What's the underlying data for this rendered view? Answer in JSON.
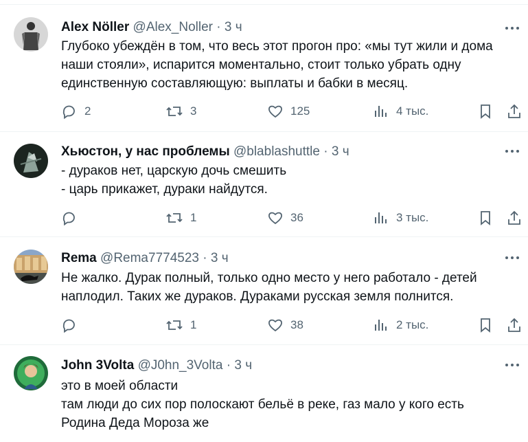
{
  "tweets": [
    {
      "name": "Alex Nöller",
      "handle": "@Alex_Noller",
      "time": "3 ч",
      "lines": [
        "Глубоко убеждён в том, что весь этот прогон про: «мы тут жили и дома",
        "наши стояли», испарится моментально, стоит только убрать одну",
        "единственную составляющую: выплаты и бабки в месяц."
      ],
      "replies": "2",
      "reposts": "3",
      "likes": "125",
      "views": "4 тыс."
    },
    {
      "name": "Хьюстон, у нас проблемы",
      "handle": "@blablashuttle",
      "time": "3 ч",
      "lines": [
        "- дураков нет, царскую дочь смешить",
        "- царь прикажет, дураки найдутся."
      ],
      "replies": "",
      "reposts": "1",
      "likes": "36",
      "views": "3 тыс."
    },
    {
      "name": "Rema",
      "handle": "@Rema7774523",
      "time": "3 ч",
      "lines": [
        "Не жалко. Дурак полный, только одно место у него работало - детей",
        "наплодил. Таких же дураков. Дураками русская земля полнится."
      ],
      "replies": "",
      "reposts": "1",
      "likes": "38",
      "views": "2 тыс."
    },
    {
      "name": "John 3Volta",
      "handle": "@J0hn_3Volta",
      "time": "3 ч",
      "lines": [
        "это в моей области",
        "там люди до сих пор полоскают бельё в реке, газ мало у кого есть",
        "Родина Деда Мороза же"
      ]
    }
  ],
  "icons": {
    "reply": "reply-icon",
    "repost": "repost-icon",
    "like": "heart-icon",
    "views": "views-icon",
    "bookmark": "bookmark-icon",
    "share": "share-icon",
    "more": "more-icon"
  },
  "colors": {
    "text": "#0f1419",
    "secondary": "#536471",
    "divider": "#eff3f4"
  }
}
